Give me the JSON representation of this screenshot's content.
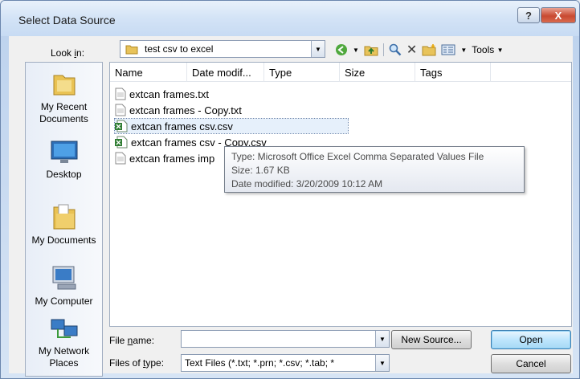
{
  "window": {
    "title": "Select Data Source",
    "help_label": "?",
    "close_label": "X"
  },
  "look_in": {
    "label": "Look in:",
    "value": "test csv to excel"
  },
  "toolbar": {
    "tools_label": "Tools"
  },
  "places": [
    {
      "label": "My Recent Documents",
      "icon": "recent-documents-icon"
    },
    {
      "label": "Desktop",
      "icon": "desktop-icon"
    },
    {
      "label": "My Documents",
      "icon": "my-documents-icon"
    },
    {
      "label": "My Computer",
      "icon": "my-computer-icon"
    },
    {
      "label": "My Network Places",
      "icon": "network-places-icon"
    }
  ],
  "columns": [
    "Name",
    "Date modif...",
    "Type",
    "Size",
    "Tags"
  ],
  "files": [
    {
      "name": "extcan frames.txt",
      "icon": "text-file-icon"
    },
    {
      "name": "extcan frames - Copy.txt",
      "icon": "text-file-icon"
    },
    {
      "name": "extcan frames csv.csv",
      "icon": "excel-csv-icon"
    },
    {
      "name": "extcan frames csv - Copy.csv",
      "icon": "excel-csv-icon"
    },
    {
      "name": "extcan frames imp",
      "icon": "text-file-icon"
    }
  ],
  "tooltip": {
    "type": "Type: Microsoft Office Excel Comma Separated Values File",
    "size": "Size: 1.67 KB",
    "date": "Date modified: 3/20/2009 10:12 AM"
  },
  "file_name": {
    "label": "File name:",
    "value": ""
  },
  "file_type": {
    "label": "Files of type:",
    "value": "Text Files (*.txt; *.prn; *.csv; *.tab; *"
  },
  "buttons": {
    "new_source": "New Source...",
    "open": "Open",
    "cancel": "Cancel"
  }
}
